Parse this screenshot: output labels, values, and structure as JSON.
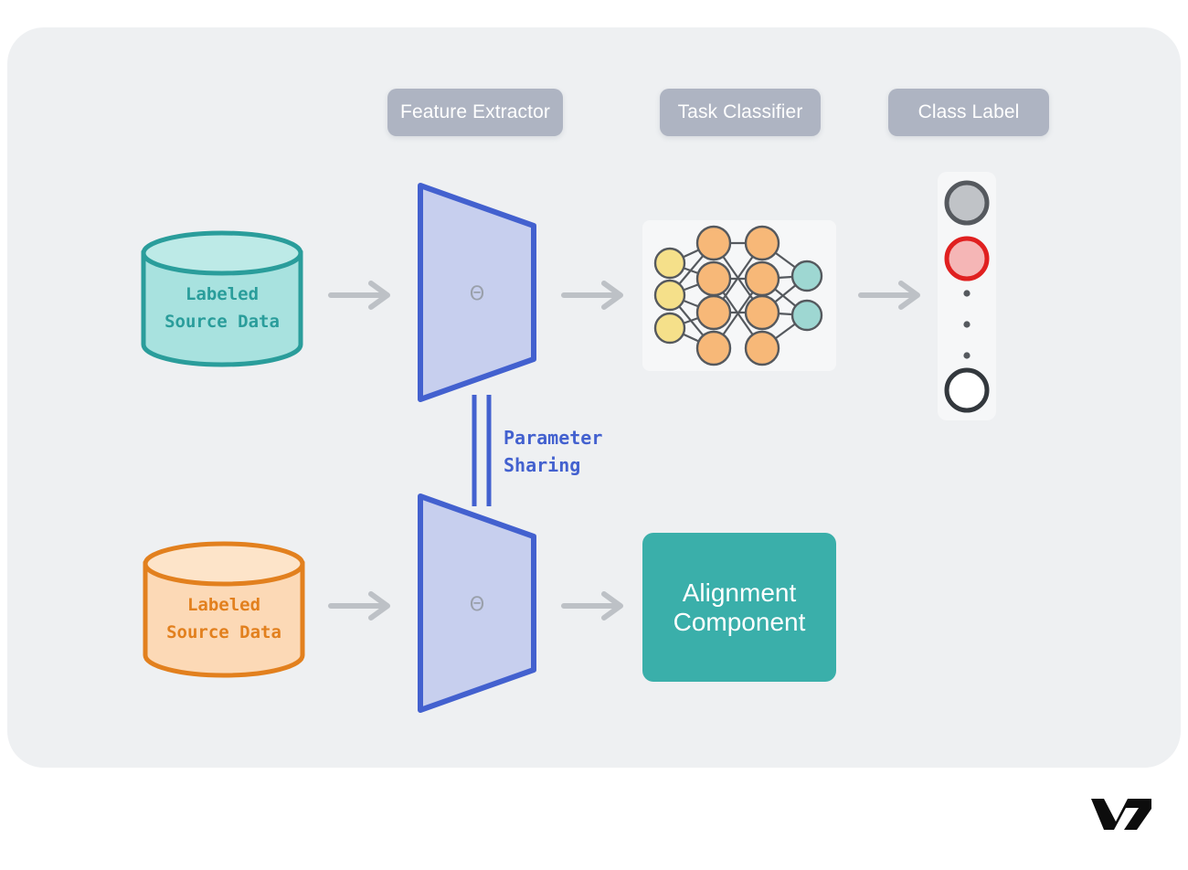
{
  "canvas": {
    "background": "#ffffff",
    "panel_background": "#eef0f2"
  },
  "header_pills": [
    {
      "id": "feature-extractor",
      "label": "Feature Extractor",
      "color": "#aeb4c2"
    },
    {
      "id": "task-classifier",
      "label": "Task Classifier",
      "color": "#aeb4c2"
    },
    {
      "id": "class-label",
      "label": "Class Label",
      "color": "#aeb4c2"
    }
  ],
  "data_sources": [
    {
      "id": "source-top",
      "line1": "Labeled",
      "line2": "Source Data",
      "stroke": "#2a9d9b",
      "fill": "#a8e2df",
      "top_fill": "#bdeae7"
    },
    {
      "id": "source-bottom",
      "line1": "Labeled",
      "line2": "Source Data",
      "stroke": "#e2801e",
      "fill": "#fcd9b6",
      "top_fill": "#fde4c9"
    }
  ],
  "feature_extractors": [
    {
      "id": "extractor-top",
      "symbol": "Θ",
      "stroke": "#4361cf",
      "fill": "#c7cfee"
    },
    {
      "id": "extractor-bottom",
      "symbol": "Θ",
      "stroke": "#4361cf",
      "fill": "#c7cfee"
    }
  ],
  "parameter_sharing": {
    "line1": "Parameter",
    "line2": "Sharing",
    "color": "#4361cf"
  },
  "neural_network": {
    "card_background": "#f6f7f8",
    "edge_color": "#55595e",
    "layers": [
      {
        "name": "input",
        "count": 3,
        "fill": "#f5e08a",
        "stroke": "#55595e"
      },
      {
        "name": "hidden1",
        "count": 4,
        "fill": "#f7b878",
        "stroke": "#55595e"
      },
      {
        "name": "hidden2",
        "count": 4,
        "fill": "#f7b878",
        "stroke": "#55595e"
      },
      {
        "name": "output",
        "count": 2,
        "fill": "#9ed7d2",
        "stroke": "#55595e"
      }
    ]
  },
  "class_label_column": {
    "background": "#f6f7f8",
    "items": [
      {
        "kind": "circle",
        "fill": "#c0c3c7",
        "stroke": "#55595e"
      },
      {
        "kind": "circle",
        "fill": "#f5b6b6",
        "stroke": "#e02020"
      },
      {
        "kind": "dot",
        "fill": "#55595e"
      },
      {
        "kind": "dot",
        "fill": "#55595e"
      },
      {
        "kind": "dot",
        "fill": "#55595e"
      },
      {
        "kind": "circle",
        "fill": "#ffffff",
        "stroke": "#33383d"
      }
    ]
  },
  "alignment_component": {
    "line1": "Alignment",
    "line2": "Component",
    "background": "#3aafaa",
    "text_color": "#ffffff"
  },
  "arrows": {
    "color": "#bdc1c6",
    "items": [
      {
        "id": "source-top-to-extractor"
      },
      {
        "id": "extractor-top-to-classifier"
      },
      {
        "id": "classifier-to-class-label"
      },
      {
        "id": "source-bottom-to-extractor"
      },
      {
        "id": "extractor-bottom-to-alignment"
      }
    ]
  },
  "branding": {
    "logo_text": "V7",
    "logo_color": "#0d0d0d"
  }
}
